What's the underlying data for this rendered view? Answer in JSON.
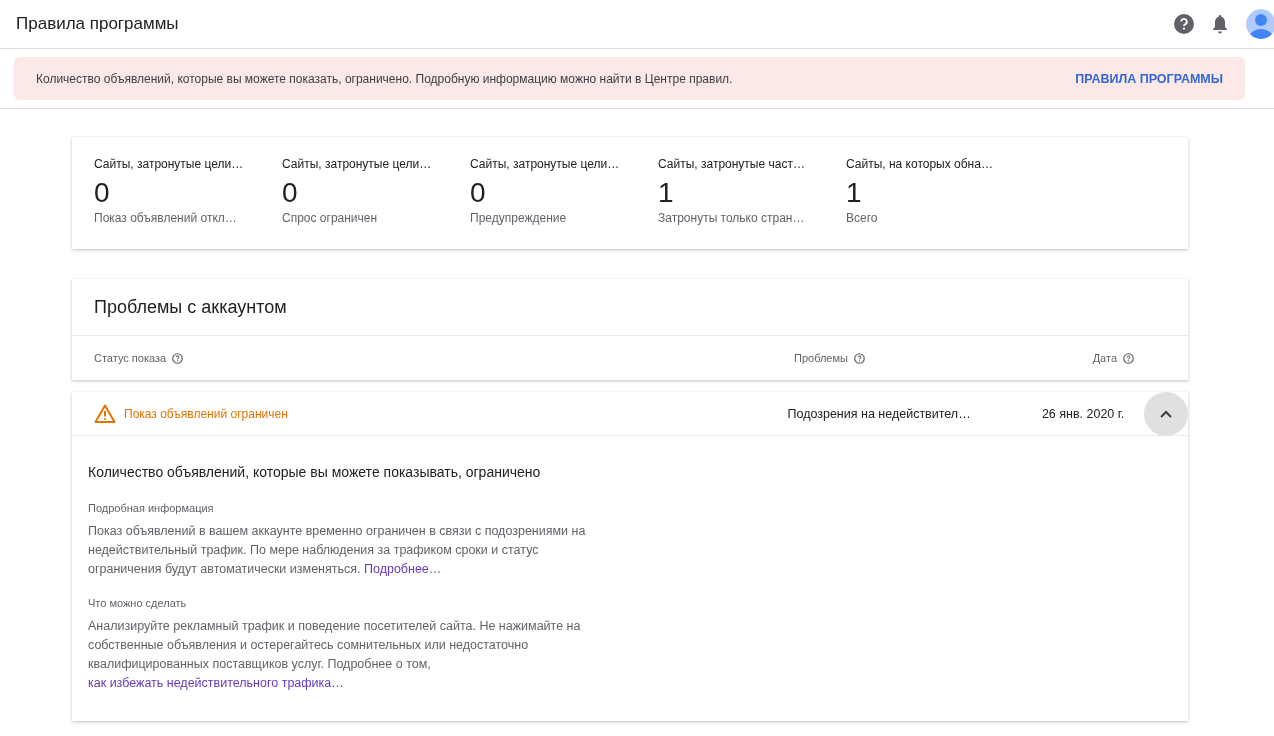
{
  "header": {
    "title": "Правила программы"
  },
  "banner": {
    "text": "Количество объявлений, которые вы можете показать, ограничено. Подробную информацию можно найти в Центре правил.",
    "action": "ПРАВИЛА ПРОГРАММЫ"
  },
  "stats": [
    {
      "title": "Сайты, затронутые цели…",
      "value": "0",
      "caption": "Показ объявлений откл…"
    },
    {
      "title": "Сайты, затронутые цели…",
      "value": "0",
      "caption": "Спрос ограничен"
    },
    {
      "title": "Сайты, затронутые цели…",
      "value": "0",
      "caption": "Предупреждение"
    },
    {
      "title": "Сайты, затронутые част…",
      "value": "1",
      "caption": "Затронуты только стран…"
    },
    {
      "title": "Сайты, на которых обна…",
      "value": "1",
      "caption": "Всего"
    }
  ],
  "issues": {
    "title": "Проблемы с аккаунтом",
    "columns": [
      "Статус показа",
      "Проблемы",
      "Дата"
    ],
    "rows": [
      {
        "kind": "warning",
        "status": "Показ объявлений ограничен",
        "problem": "Подозрения на недействител…",
        "date": "26 янв. 2020 г.",
        "expanded": true,
        "details": {
          "heading": "Количество объявлений, которые вы можете показывать, ограничено",
          "sections": [
            {
              "label": "Подробная информация",
              "text": "Показ объявлений в вашем аккаунте временно ограничен в связи с подозрениями на недействительный трафик. По мере наблюдения за трафиком сроки и статус ограничения будут автоматически изменяться.",
              "link": "Подробнее…"
            },
            {
              "label": "Что можно сделать",
              "text": "Анализируйте рекламный трафик и поведение посетителей сайта. Не нажимайте на собственные объявления и остерегайтесь сомнительных или недостаточно квалифицированных поставщиков услуг. Подробнее о том,",
              "link": "как избежать недействительного трафика…"
            }
          ]
        }
      }
    ]
  }
}
